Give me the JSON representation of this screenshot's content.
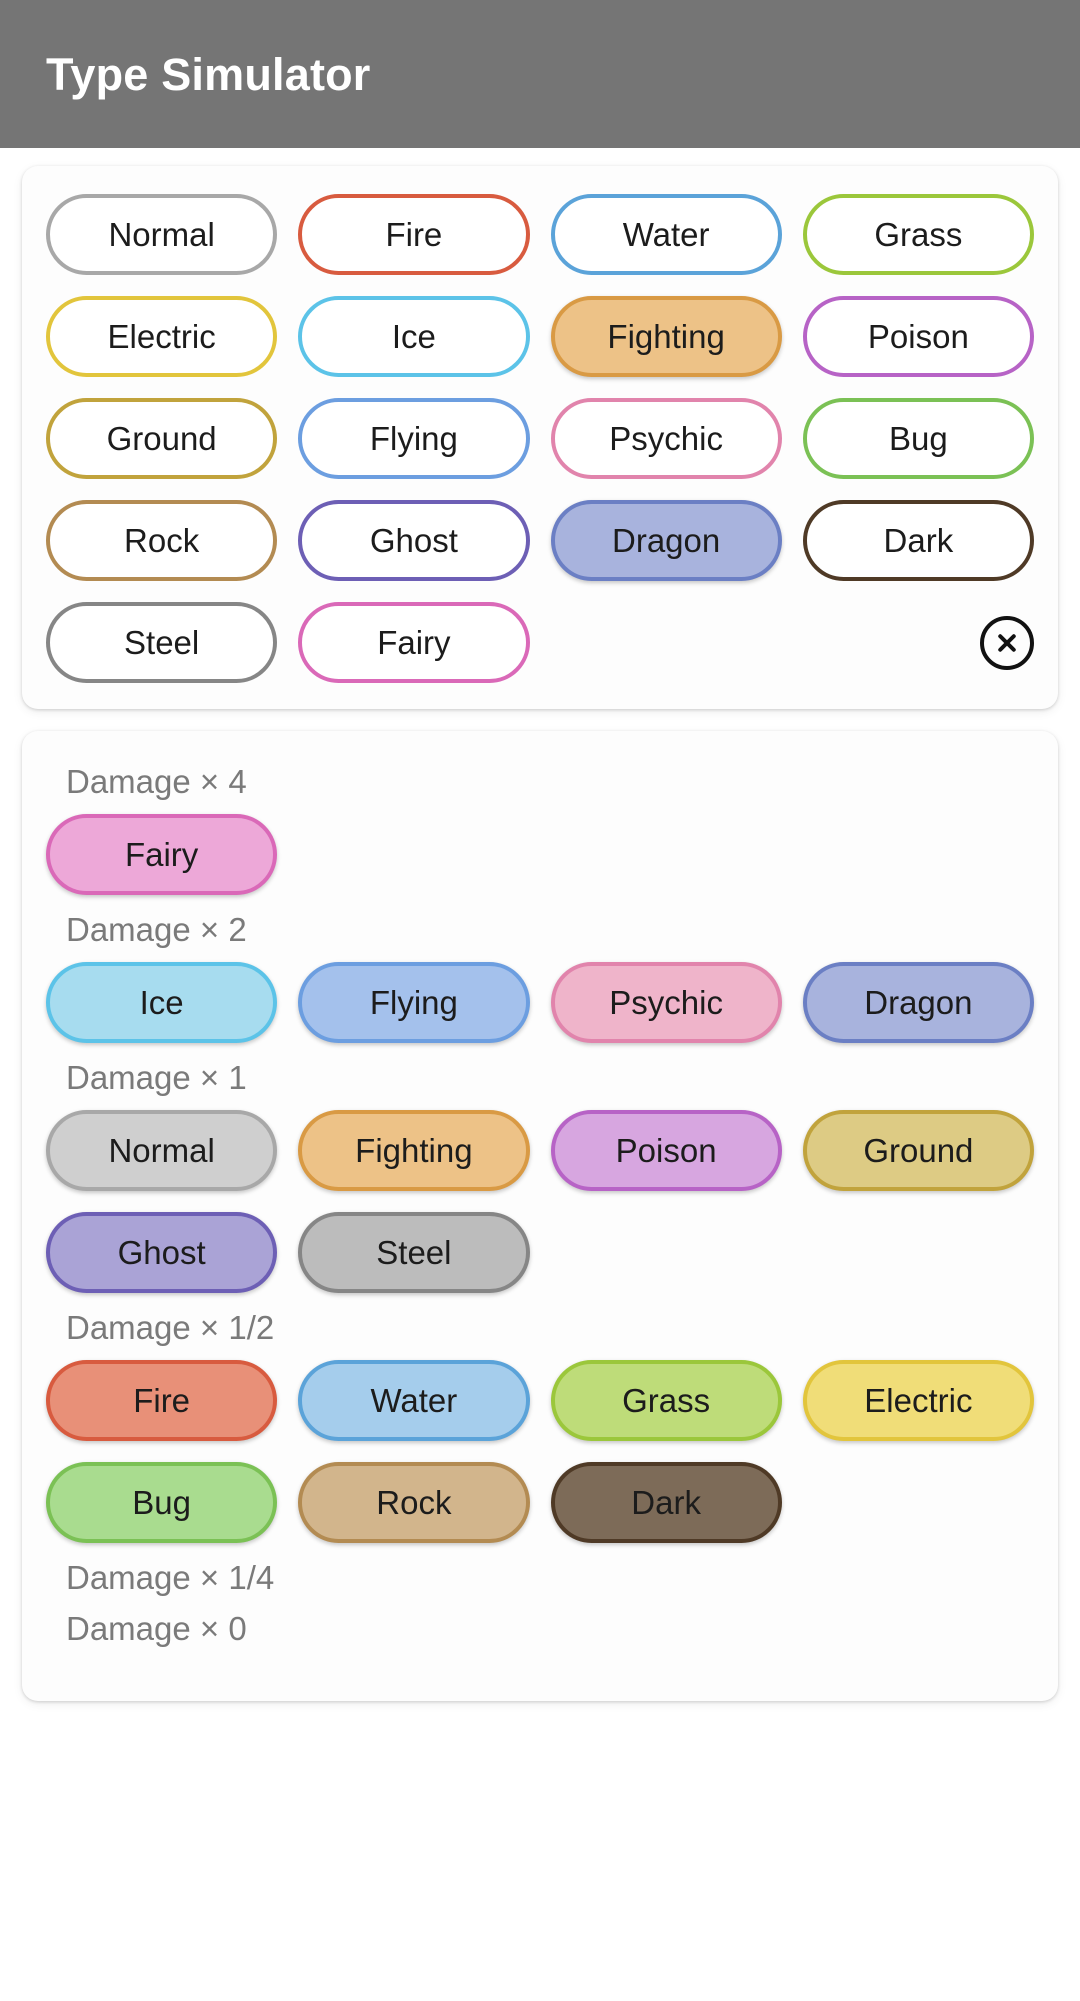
{
  "app": {
    "title": "Type Simulator",
    "header_bg": "#757575",
    "header_text": "#ffffff",
    "page_bg": "#ffffff",
    "card_bg": "#fdfdfd"
  },
  "type_colors": {
    "Normal": {
      "border": "#a8a8a8",
      "fill": "#cfcfcf"
    },
    "Fire": {
      "border": "#d85b3f",
      "fill": "#e89078"
    },
    "Water": {
      "border": "#5ba3d9",
      "fill": "#a5cdec"
    },
    "Grass": {
      "border": "#9bc73b",
      "fill": "#bedc79"
    },
    "Electric": {
      "border": "#e2c53c",
      "fill": "#f0dd78"
    },
    "Ice": {
      "border": "#5cc3e8",
      "fill": "#a7dcef"
    },
    "Fighting": {
      "border": "#d99a44",
      "fill": "#edc287"
    },
    "Poison": {
      "border": "#b763c6",
      "fill": "#d7a6e0"
    },
    "Ground": {
      "border": "#c1a33c",
      "fill": "#ddcb84"
    },
    "Flying": {
      "border": "#6c9ee0",
      "fill": "#a4c1ec"
    },
    "Psychic": {
      "border": "#e184ac",
      "fill": "#efb4ca"
    },
    "Bug": {
      "border": "#7bc155",
      "fill": "#a9dc8f"
    },
    "Rock": {
      "border": "#b38b52",
      "fill": "#d2b58c"
    },
    "Ghost": {
      "border": "#6d5fb5",
      "fill": "#aaa3d6"
    },
    "Dragon": {
      "border": "#6b7fc4",
      "fill": "#a8b3dd"
    },
    "Dark": {
      "border": "#4f3a26",
      "fill": "#7d6b58"
    },
    "Steel": {
      "border": "#868686",
      "fill": "#bcbcbc"
    },
    "Fairy": {
      "border": "#da69b8",
      "fill": "#eda8d8"
    }
  },
  "selector": {
    "types": [
      {
        "label": "Normal",
        "selected": false
      },
      {
        "label": "Fire",
        "selected": false
      },
      {
        "label": "Water",
        "selected": false
      },
      {
        "label": "Grass",
        "selected": false
      },
      {
        "label": "Electric",
        "selected": false
      },
      {
        "label": "Ice",
        "selected": false
      },
      {
        "label": "Fighting",
        "selected": true
      },
      {
        "label": "Poison",
        "selected": false
      },
      {
        "label": "Ground",
        "selected": false
      },
      {
        "label": "Flying",
        "selected": false
      },
      {
        "label": "Psychic",
        "selected": false
      },
      {
        "label": "Bug",
        "selected": false
      },
      {
        "label": "Rock",
        "selected": false
      },
      {
        "label": "Ghost",
        "selected": false
      },
      {
        "label": "Dragon",
        "selected": true
      },
      {
        "label": "Dark",
        "selected": false
      },
      {
        "label": "Steel",
        "selected": false
      },
      {
        "label": "Fairy",
        "selected": false
      }
    ],
    "clear_icon": "close-circle-icon"
  },
  "results": {
    "groups": [
      {
        "label": "Damage × 4",
        "multiplier": "4",
        "types": [
          "Fairy"
        ]
      },
      {
        "label": "Damage × 2",
        "multiplier": "2",
        "types": [
          "Ice",
          "Flying",
          "Psychic",
          "Dragon"
        ]
      },
      {
        "label": "Damage × 1",
        "multiplier": "1",
        "types": [
          "Normal",
          "Fighting",
          "Poison",
          "Ground",
          "Ghost",
          "Steel"
        ]
      },
      {
        "label": "Damage × 1/2",
        "multiplier": "1/2",
        "types": [
          "Fire",
          "Water",
          "Grass",
          "Electric",
          "Bug",
          "Rock",
          "Dark"
        ]
      },
      {
        "label": "Damage × 1/4",
        "multiplier": "1/4",
        "types": []
      },
      {
        "label": "Damage × 0",
        "multiplier": "0",
        "types": []
      }
    ]
  }
}
